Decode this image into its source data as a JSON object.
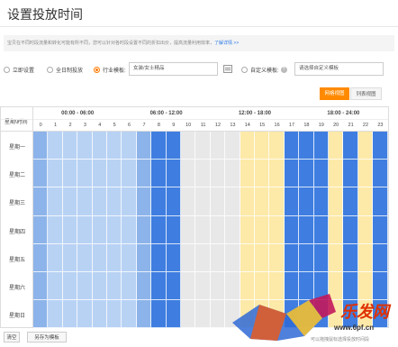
{
  "title": "设置投放时间",
  "notice": {
    "text": "宝贝在不同时段流量和转化可能有所不同，您可以针对各时段设置不同的折扣出价，提高流量利用效率，",
    "link": "了解详情 >>"
  },
  "options": {
    "immediate": "立即设置",
    "all_day": "全日制投放",
    "industry": "行业模板:",
    "industry_value": "女装/女士精品",
    "custom": "自定义模板:",
    "custom_placeholder": "请选择自定义模板"
  },
  "view": {
    "chart": "网格视图",
    "list": "列表视图"
  },
  "grid_header": {
    "corner": "星期\\时间",
    "ranges": [
      "00:00 - 06:00",
      "06:00 - 12:00",
      "12:00 - 18:00",
      "18:00 - 24:00"
    ],
    "hours": [
      "0",
      "1",
      "2",
      "3",
      "4",
      "5",
      "6",
      "7",
      "8",
      "9",
      "10",
      "11",
      "12",
      "13",
      "14",
      "15",
      "16",
      "17",
      "18",
      "19",
      "20",
      "21",
      "22",
      "23"
    ]
  },
  "days": [
    "星期一",
    "星期二",
    "星期三",
    "星期四",
    "星期五",
    "星期六",
    "星期日"
  ],
  "hour_levels": [
    "mid",
    "light",
    "light",
    "light",
    "light",
    "light",
    "light",
    "mid",
    "dark",
    "dark",
    "gray",
    "gray",
    "gray",
    "gray",
    "yellow",
    "yellow",
    "yellow",
    "dark",
    "dark",
    "dark",
    "yellow",
    "dark",
    "yellow",
    "dark"
  ],
  "colors": {
    "dark": "#3f7ee0",
    "mid": "#8db4ea",
    "light": "#b8d2f4",
    "gray": "#e8e8e8",
    "yellow": "#fde9a8",
    "accent": "#ff8a00"
  },
  "buttons": {
    "clear": "清空",
    "save": "另存为模板"
  },
  "watermark": {
    "brand": "乐发网",
    "url": "www.6pf.cn",
    "caption": "可以拖拽鼠标选择投放时间段"
  }
}
